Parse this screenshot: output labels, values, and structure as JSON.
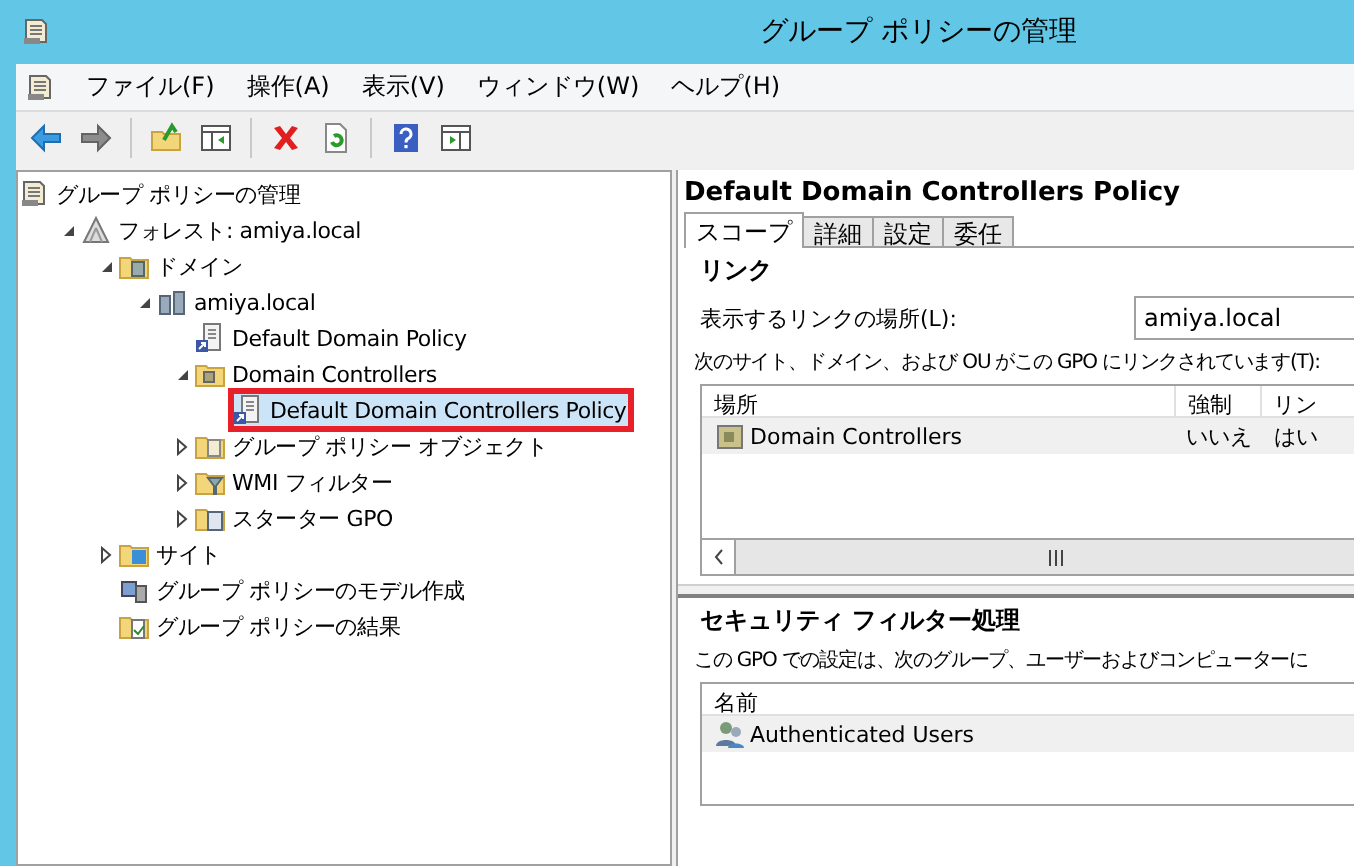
{
  "window": {
    "title": "グループ ポリシーの管理"
  },
  "menu": [
    "ファイル(F)",
    "操作(A)",
    "表示(V)",
    "ウィンドウ(W)",
    "ヘルプ(H)"
  ],
  "toolbar": [
    {
      "kind": "back",
      "disabled": false
    },
    {
      "kind": "forward",
      "disabled": true
    },
    {
      "kind": "sep"
    },
    {
      "kind": "up",
      "disabled": false
    },
    {
      "kind": "pane",
      "disabled": false
    },
    {
      "kind": "sep"
    },
    {
      "kind": "delete",
      "disabled": false
    },
    {
      "kind": "refresh",
      "disabled": false
    },
    {
      "kind": "sep"
    },
    {
      "kind": "help",
      "disabled": false
    },
    {
      "kind": "action-pane",
      "disabled": false
    }
  ],
  "tree": [
    {
      "label": "グループ ポリシーの管理",
      "kind": "console",
      "selected": false,
      "children": [
        {
          "label": "フォレスト: amiya.local",
          "kind": "forest",
          "selected": false,
          "expanded": true,
          "children": [
            {
              "label": "ドメイン",
              "kind": "domains",
              "selected": false,
              "expanded": true,
              "children": [
                {
                  "label": "amiya.local",
                  "kind": "domain",
                  "selected": false,
                  "expanded": true,
                  "children": [
                    {
                      "label": "Default Domain Policy",
                      "kind": "gpo",
                      "selected": false
                    },
                    {
                      "label": "Domain Controllers",
                      "kind": "ou",
                      "selected": false,
                      "expanded": true,
                      "children": [
                        {
                          "label": "Default Domain Controllers Policy",
                          "kind": "gpo",
                          "selected": true
                        }
                      ]
                    },
                    {
                      "label": "グループ ポリシー オブジェクト",
                      "kind": "gpo-folder",
                      "selected": false,
                      "expanded": false
                    },
                    {
                      "label": "WMI フィルター",
                      "kind": "wmi-folder",
                      "selected": false,
                      "expanded": false
                    },
                    {
                      "label": "スターター GPO",
                      "kind": "starter-folder",
                      "selected": false,
                      "expanded": false
                    }
                  ]
                }
              ]
            },
            {
              "label": "サイト",
              "kind": "sites",
              "selected": false,
              "expanded": false
            },
            {
              "label": "グループ ポリシーのモデル作成",
              "kind": "modeling",
              "selected": false
            },
            {
              "label": "グループ ポリシーの結果",
              "kind": "results",
              "selected": false
            }
          ]
        }
      ]
    }
  ],
  "detail": {
    "title": "Default Domain Controllers Policy",
    "tabs": [
      {
        "label": "スコープ",
        "selected": true
      },
      {
        "label": "詳細",
        "selected": false
      },
      {
        "label": "設定",
        "selected": false
      },
      {
        "label": "委任",
        "selected": false
      }
    ],
    "links": {
      "heading": "リンク",
      "location_label": "表示するリンクの場所(L):",
      "location_value": "amiya.local",
      "description": "次のサイト、ドメイン、および OU がこの GPO にリンクされています(T):",
      "columns": [
        "場所",
        "強制",
        "リン"
      ],
      "rows": [
        [
          "Domain Controllers",
          "いいえ",
          "はい"
        ]
      ]
    },
    "security": {
      "heading": "セキュリティ フィルター処理",
      "description": "この GPO での設定は、次のグループ、ユーザーおよびコンピューターに",
      "columns": [
        "名前"
      ],
      "rows": [
        [
          "Authenticated Users"
        ]
      ]
    }
  }
}
